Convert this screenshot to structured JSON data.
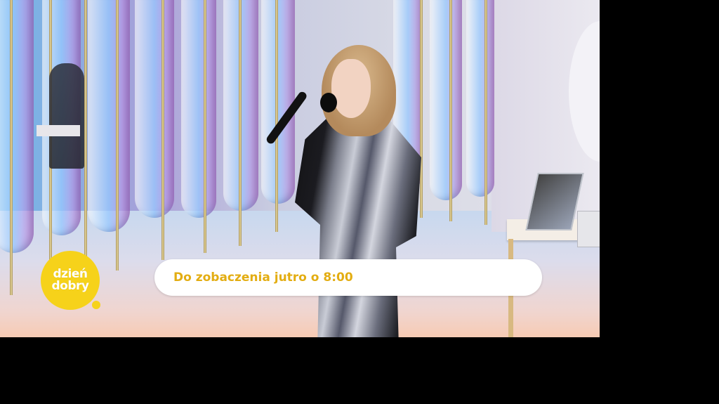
{
  "caption": {
    "text": "Do zobaczenia jutro o 8:00"
  },
  "logo": {
    "line1": "dzień",
    "line2": "dobry"
  },
  "colors": {
    "logo_yellow": "#f6d21a",
    "caption_text": "#e3ad12",
    "caption_bg": "#ffffff",
    "letterbox": "#000000"
  }
}
